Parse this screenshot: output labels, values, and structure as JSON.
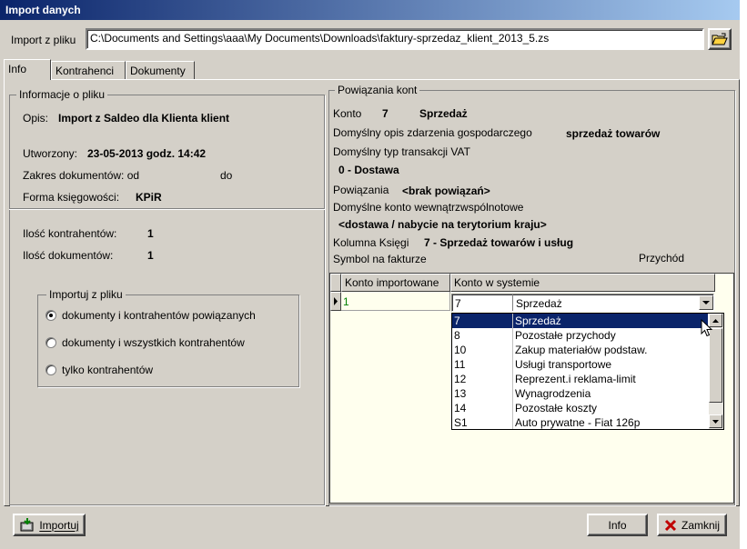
{
  "window": {
    "title": "Import danych"
  },
  "import_bar": {
    "label": "Import z pliku",
    "path": "C:\\Documents and Settings\\aaa\\My Documents\\Downloads\\faktury-sprzedaz_klient_2013_5.zs"
  },
  "tabs": [
    {
      "label": "Info",
      "active": true
    },
    {
      "label": "Kontrahenci",
      "active": false
    },
    {
      "label": "Dokumenty",
      "active": false
    }
  ],
  "file_info": {
    "group_label": "Informacje o pliku",
    "opis_label": "Opis:",
    "opis_value": "Import z Saldeo dla Klienta klient",
    "created_label": "Utworzony:",
    "created_value": "23-05-2013 godz. 14:42",
    "range_label": "Zakres dokumentów: od",
    "range_to_label": "do",
    "accounting_label": "Forma księgowości:",
    "accounting_value": "KPiR",
    "contractors_count_label": "Ilość kontrahentów:",
    "contractors_count_value": "1",
    "documents_count_label": "Ilość dokumentów:",
    "documents_count_value": "1"
  },
  "import_options": {
    "group_label": "Importuj z pliku",
    "options": [
      {
        "label": "dokumenty i kontrahentów powiązanych",
        "checked": true
      },
      {
        "label": "dokumenty i wszystkich kontrahentów",
        "checked": false
      },
      {
        "label": "tylko kontrahentów",
        "checked": false
      }
    ]
  },
  "accounts": {
    "group_label": "Powiązania kont",
    "konto_label": "Konto",
    "konto_number": "7",
    "konto_name": "Sprzedaż",
    "default_desc_label": "Domyślny opis zdarzenia gospodarczego",
    "default_desc_value": "sprzedaż towarów",
    "vat_label": "Domyślny typ transakcji VAT",
    "vat_value": "0 - Dostawa",
    "links_label": "Powiązania",
    "links_value": "<brak powiązań>",
    "internal_label": "Domyślne konto wewnątrzwspólnotowe",
    "internal_value": "<dostawa / nabycie na terytorium kraju>",
    "column_label": "Kolumna Księgi",
    "column_value": "7 - Sprzedaż towarów i usług",
    "symbol_label": "Symbol na fakturze",
    "symbol_value": "Przychód"
  },
  "grid": {
    "col1": "Konto importowane",
    "col2": "Konto w systemie",
    "row": {
      "imported": "1",
      "system_number": "7",
      "system_name": "Sprzedaż"
    }
  },
  "dropdown": {
    "items": [
      {
        "number": "7",
        "name": "Sprzedaż",
        "selected": true
      },
      {
        "number": "8",
        "name": "Pozostałe przychody",
        "selected": false
      },
      {
        "number": "10",
        "name": "Zakup materiałów podstaw.",
        "selected": false
      },
      {
        "number": "11",
        "name": "Usługi transportowe",
        "selected": false
      },
      {
        "number": "12",
        "name": "Reprezent.i reklama-limit",
        "selected": false
      },
      {
        "number": "13",
        "name": "Wynagrodzenia",
        "selected": false
      },
      {
        "number": "14",
        "name": "Pozostałe koszty",
        "selected": false
      },
      {
        "number": "S1",
        "name": "Auto prywatne - Fiat 126p",
        "selected": false
      }
    ]
  },
  "buttons": {
    "import": "Importuj",
    "info": "Info",
    "close": "Zamknij"
  },
  "colors": {
    "titlebar": "#0a246a",
    "selection": "#0a246a",
    "grid_value": "#008000"
  }
}
